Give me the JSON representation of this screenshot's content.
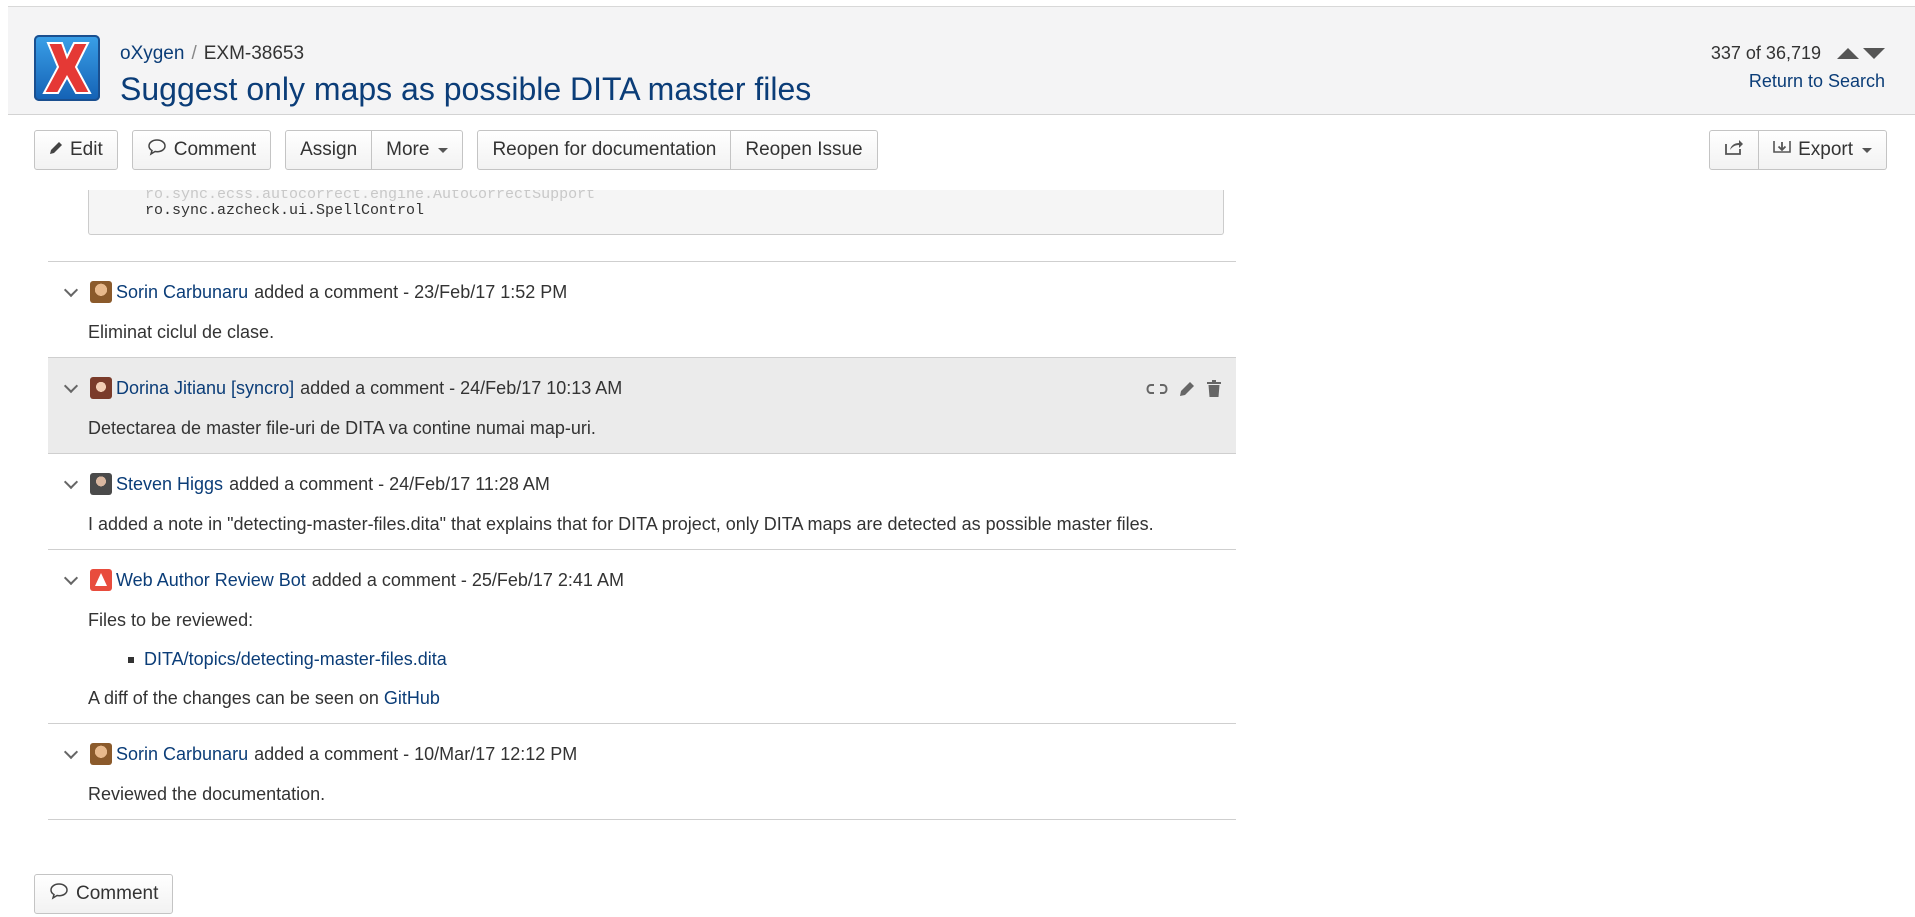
{
  "header": {
    "project": "oXygen",
    "separator": "/",
    "issue_key": "EXM-38653",
    "title": "Suggest only maps as possible DITA master files",
    "pager_text": "337 of 36,719",
    "return_link": "Return to Search"
  },
  "toolbar": {
    "edit": "Edit",
    "comment": "Comment",
    "assign": "Assign",
    "more": "More",
    "reopen_doc": "Reopen for documentation",
    "reopen_issue": "Reopen Issue",
    "export": "Export"
  },
  "code": {
    "faded_line": "ro.sync.ecss.autocorrect.engine.AutoCorrectSupport",
    "line": "ro.sync.azcheck.ui.SpellControl"
  },
  "comments": [
    {
      "author": "Sorin Carbunaru",
      "meta": "added a comment - 23/Feb/17 1:52 PM",
      "body": "Eliminat ciclul de clase."
    },
    {
      "author": "Dorina Jitianu [syncro]",
      "meta": "added a comment - 24/Feb/17 10:13 AM",
      "body": "Detectarea de master file-uri de DITA va contine numai map-uri."
    },
    {
      "author": "Steven Higgs",
      "meta": "added a comment - 24/Feb/17 11:28 AM",
      "body": "I added a note in \"detecting-master-files.dita\" that explains that for DITA project, only DITA maps are detected as possible master files."
    },
    {
      "author": "Web Author Review Bot",
      "meta": "added a comment - 25/Feb/17 2:41 AM",
      "body_intro": "Files to be reviewed:",
      "file_link": "DITA/topics/detecting-master-files.dita",
      "diff_text": "A diff of the changes can be seen on",
      "diff_link": "GitHub"
    },
    {
      "author": "Sorin Carbunaru",
      "meta": "added a comment - 10/Mar/17 12:12 PM",
      "body": "Reviewed the documentation."
    }
  ],
  "footer": {
    "comment_button": "Comment"
  },
  "colors": {
    "link": "#0b3d78",
    "header_bg": "#f4f4f5",
    "highlight_bg": "#ebebeb"
  }
}
